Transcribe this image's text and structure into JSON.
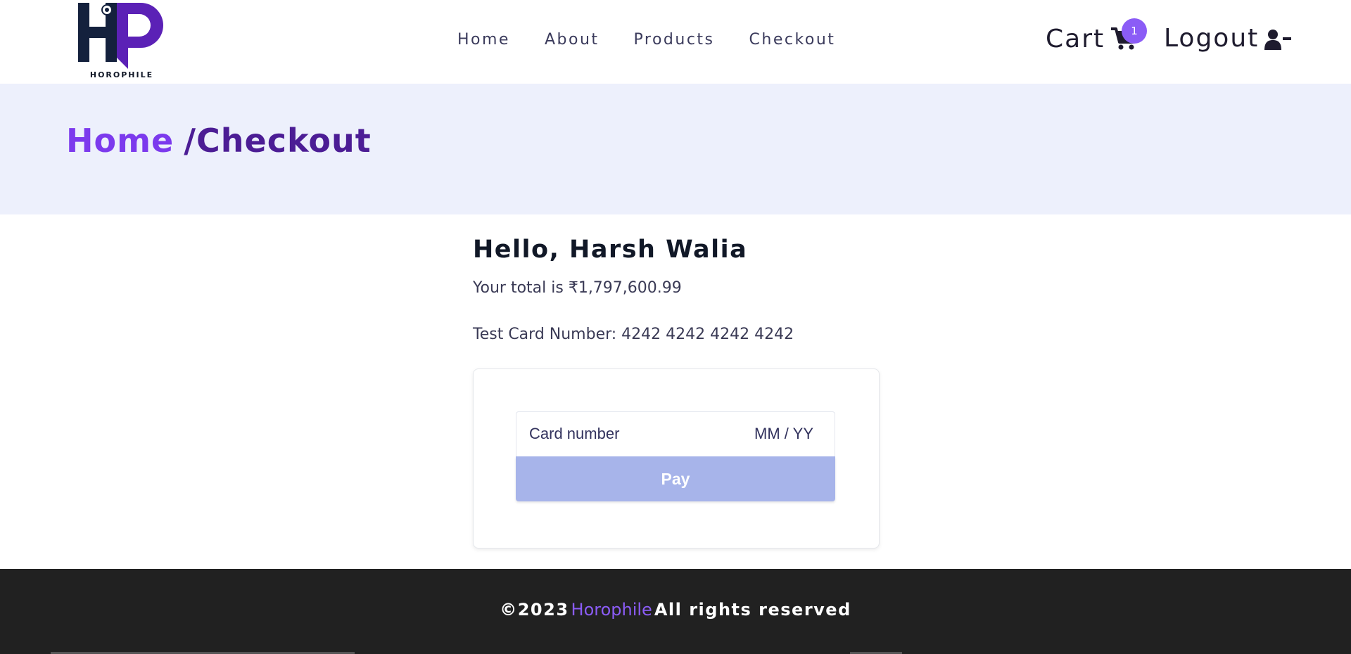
{
  "brand": {
    "name": "HOROPHILE"
  },
  "nav": {
    "items": [
      {
        "label": "Home"
      },
      {
        "label": "About"
      },
      {
        "label": "Products"
      },
      {
        "label": "Checkout"
      }
    ]
  },
  "cart": {
    "label": "Cart",
    "count": "1",
    "icon": "cart-icon"
  },
  "logout": {
    "label": "Logout",
    "icon": "user-minus-icon"
  },
  "breadcrumb": {
    "home": "Home",
    "current": "/Checkout"
  },
  "main": {
    "greeting": "Hello, Harsh Walia",
    "total": "Your total is ₹1,797,600.99",
    "test_card": "Test Card Number: 4242 4242 4242 4242"
  },
  "payment": {
    "card_placeholder": "Card number",
    "exp_placeholder": "MM / YY",
    "pay_label": "Pay"
  },
  "footer": {
    "copyright": "©2023",
    "brand": "Horophile",
    "rights": "All rights reserved"
  },
  "colors": {
    "accent": "#8b5cf6",
    "band_bg": "#edf0fc",
    "pay_button": "#a7b4ea",
    "footer_bg": "#212121"
  }
}
